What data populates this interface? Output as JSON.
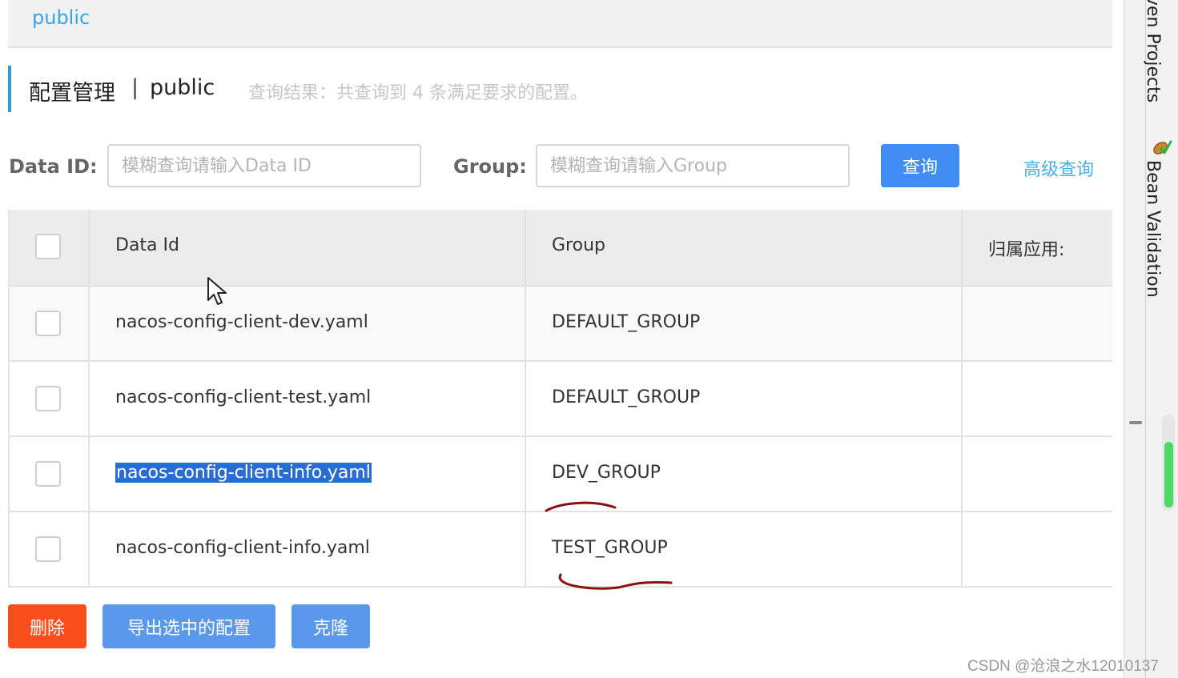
{
  "namespace_bar": {
    "namespace": "public"
  },
  "title": {
    "main": "配置管理",
    "separator": "|",
    "namespace": "public",
    "result": "查询结果：共查询到 4 条满足要求的配置。"
  },
  "search": {
    "data_id_label": "Data ID:",
    "data_id_placeholder": "模糊查询请输入Data ID",
    "group_label": "Group:",
    "group_placeholder": "模糊查询请输入Group",
    "query_button": "查询",
    "advanced_link": "高级查询"
  },
  "table": {
    "headers": [
      "Data Id",
      "Group",
      "归属应用:"
    ],
    "rows": [
      {
        "data_id": "nacos-config-client-dev.yaml",
        "group": "DEFAULT_GROUP",
        "app": ""
      },
      {
        "data_id": "nacos-config-client-test.yaml",
        "group": "DEFAULT_GROUP",
        "app": ""
      },
      {
        "data_id": "nacos-config-client-info.yaml",
        "group": "DEV_GROUP",
        "app": ""
      },
      {
        "data_id": "nacos-config-client-info.yaml",
        "group": "TEST_GROUP",
        "app": ""
      }
    ]
  },
  "actions": {
    "delete": "删除",
    "export_selected": "导出选中的配置",
    "clone": "克隆"
  },
  "ide_panel": {
    "tab_maven": "ven Projects",
    "tab_bean_validation": "Bean Validation",
    "bean_icon": "bean-validation-icon"
  },
  "watermark": "CSDN @沧浪之水12010137",
  "colors": {
    "primary": "#3f8df2",
    "danger": "#fa4f1c",
    "link": "#4aafe8",
    "accent_bar": "#2d9bd6",
    "annotation": "#8b1010"
  }
}
